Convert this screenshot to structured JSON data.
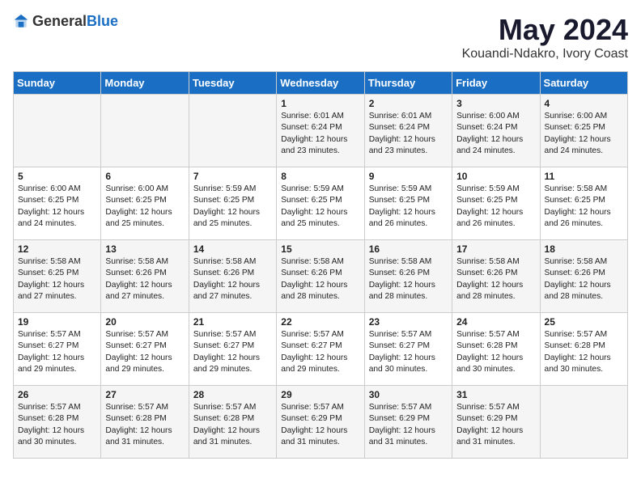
{
  "logo": {
    "general": "General",
    "blue": "Blue"
  },
  "header": {
    "title": "May 2024",
    "subtitle": "Kouandi-Ndakro, Ivory Coast"
  },
  "weekdays": [
    "Sunday",
    "Monday",
    "Tuesday",
    "Wednesday",
    "Thursday",
    "Friday",
    "Saturday"
  ],
  "weeks": [
    [
      {
        "day": "",
        "info": ""
      },
      {
        "day": "",
        "info": ""
      },
      {
        "day": "",
        "info": ""
      },
      {
        "day": "1",
        "info": "Sunrise: 6:01 AM\nSunset: 6:24 PM\nDaylight: 12 hours\nand 23 minutes."
      },
      {
        "day": "2",
        "info": "Sunrise: 6:01 AM\nSunset: 6:24 PM\nDaylight: 12 hours\nand 23 minutes."
      },
      {
        "day": "3",
        "info": "Sunrise: 6:00 AM\nSunset: 6:24 PM\nDaylight: 12 hours\nand 24 minutes."
      },
      {
        "day": "4",
        "info": "Sunrise: 6:00 AM\nSunset: 6:25 PM\nDaylight: 12 hours\nand 24 minutes."
      }
    ],
    [
      {
        "day": "5",
        "info": "Sunrise: 6:00 AM\nSunset: 6:25 PM\nDaylight: 12 hours\nand 24 minutes."
      },
      {
        "day": "6",
        "info": "Sunrise: 6:00 AM\nSunset: 6:25 PM\nDaylight: 12 hours\nand 25 minutes."
      },
      {
        "day": "7",
        "info": "Sunrise: 5:59 AM\nSunset: 6:25 PM\nDaylight: 12 hours\nand 25 minutes."
      },
      {
        "day": "8",
        "info": "Sunrise: 5:59 AM\nSunset: 6:25 PM\nDaylight: 12 hours\nand 25 minutes."
      },
      {
        "day": "9",
        "info": "Sunrise: 5:59 AM\nSunset: 6:25 PM\nDaylight: 12 hours\nand 26 minutes."
      },
      {
        "day": "10",
        "info": "Sunrise: 5:59 AM\nSunset: 6:25 PM\nDaylight: 12 hours\nand 26 minutes."
      },
      {
        "day": "11",
        "info": "Sunrise: 5:58 AM\nSunset: 6:25 PM\nDaylight: 12 hours\nand 26 minutes."
      }
    ],
    [
      {
        "day": "12",
        "info": "Sunrise: 5:58 AM\nSunset: 6:25 PM\nDaylight: 12 hours\nand 27 minutes."
      },
      {
        "day": "13",
        "info": "Sunrise: 5:58 AM\nSunset: 6:26 PM\nDaylight: 12 hours\nand 27 minutes."
      },
      {
        "day": "14",
        "info": "Sunrise: 5:58 AM\nSunset: 6:26 PM\nDaylight: 12 hours\nand 27 minutes."
      },
      {
        "day": "15",
        "info": "Sunrise: 5:58 AM\nSunset: 6:26 PM\nDaylight: 12 hours\nand 28 minutes."
      },
      {
        "day": "16",
        "info": "Sunrise: 5:58 AM\nSunset: 6:26 PM\nDaylight: 12 hours\nand 28 minutes."
      },
      {
        "day": "17",
        "info": "Sunrise: 5:58 AM\nSunset: 6:26 PM\nDaylight: 12 hours\nand 28 minutes."
      },
      {
        "day": "18",
        "info": "Sunrise: 5:58 AM\nSunset: 6:26 PM\nDaylight: 12 hours\nand 28 minutes."
      }
    ],
    [
      {
        "day": "19",
        "info": "Sunrise: 5:57 AM\nSunset: 6:27 PM\nDaylight: 12 hours\nand 29 minutes."
      },
      {
        "day": "20",
        "info": "Sunrise: 5:57 AM\nSunset: 6:27 PM\nDaylight: 12 hours\nand 29 minutes."
      },
      {
        "day": "21",
        "info": "Sunrise: 5:57 AM\nSunset: 6:27 PM\nDaylight: 12 hours\nand 29 minutes."
      },
      {
        "day": "22",
        "info": "Sunrise: 5:57 AM\nSunset: 6:27 PM\nDaylight: 12 hours\nand 29 minutes."
      },
      {
        "day": "23",
        "info": "Sunrise: 5:57 AM\nSunset: 6:27 PM\nDaylight: 12 hours\nand 30 minutes."
      },
      {
        "day": "24",
        "info": "Sunrise: 5:57 AM\nSunset: 6:28 PM\nDaylight: 12 hours\nand 30 minutes."
      },
      {
        "day": "25",
        "info": "Sunrise: 5:57 AM\nSunset: 6:28 PM\nDaylight: 12 hours\nand 30 minutes."
      }
    ],
    [
      {
        "day": "26",
        "info": "Sunrise: 5:57 AM\nSunset: 6:28 PM\nDaylight: 12 hours\nand 30 minutes."
      },
      {
        "day": "27",
        "info": "Sunrise: 5:57 AM\nSunset: 6:28 PM\nDaylight: 12 hours\nand 31 minutes."
      },
      {
        "day": "28",
        "info": "Sunrise: 5:57 AM\nSunset: 6:28 PM\nDaylight: 12 hours\nand 31 minutes."
      },
      {
        "day": "29",
        "info": "Sunrise: 5:57 AM\nSunset: 6:29 PM\nDaylight: 12 hours\nand 31 minutes."
      },
      {
        "day": "30",
        "info": "Sunrise: 5:57 AM\nSunset: 6:29 PM\nDaylight: 12 hours\nand 31 minutes."
      },
      {
        "day": "31",
        "info": "Sunrise: 5:57 AM\nSunset: 6:29 PM\nDaylight: 12 hours\nand 31 minutes."
      },
      {
        "day": "",
        "info": ""
      }
    ]
  ]
}
